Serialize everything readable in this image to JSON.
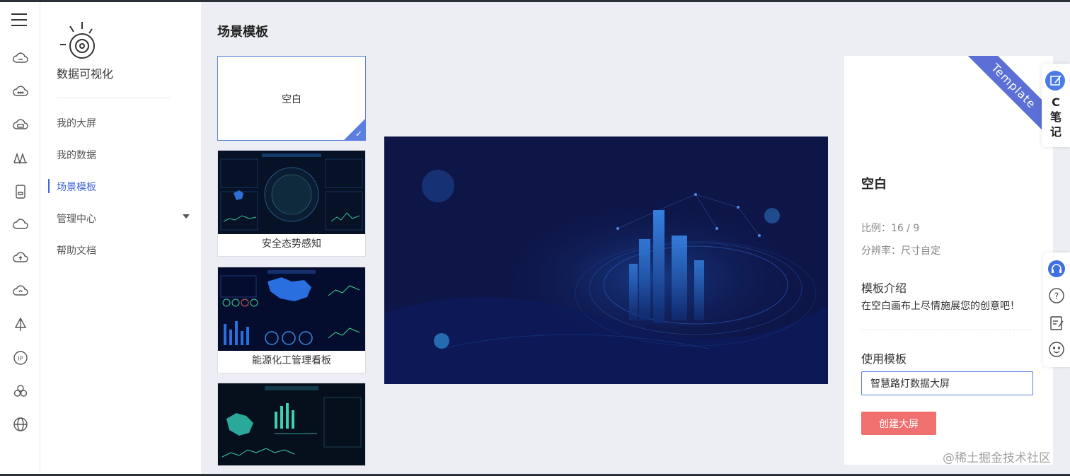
{
  "app": {
    "brand": "数据可视化"
  },
  "rail": {
    "icons": [
      "menu-icon",
      "cloud-icon",
      "cloud-dots-icon",
      "cloud-server-icon",
      "bridge-icon",
      "storage-icon",
      "cloud-icon",
      "cloud-upload-icon",
      "cloud-sync-icon",
      "sail-icon",
      "ip-icon",
      "cluster-icon",
      "globe-icon"
    ]
  },
  "nav": {
    "items": [
      {
        "label": "我的大屏"
      },
      {
        "label": "我的数据"
      },
      {
        "label": "场景模板",
        "active": true
      },
      {
        "label": "管理中心",
        "expandable": true
      },
      {
        "label": "帮助文档"
      }
    ]
  },
  "page": {
    "title": "场景模板"
  },
  "templates": [
    {
      "name": "空白",
      "selected": true
    },
    {
      "name": "安全态势感知"
    },
    {
      "name": "能源化工管理看板"
    },
    {
      "name": ""
    }
  ],
  "detail": {
    "ribbon": "Template",
    "title": "空白",
    "ratio": "比例：16 / 9",
    "resolution": "分辨率：尺寸自定",
    "intro_heading": "模板介绍",
    "intro_text": "在空白画布上尽情施展您的创意吧！",
    "use_label": "使用模板",
    "name_value": "智慧路灯数据大屏",
    "create_button": "创建大屏"
  },
  "floating": {
    "note_text": "C笔记"
  },
  "watermark": "@稀土掘金技术社区",
  "colors": {
    "accent": "#3f65d8",
    "button": "#f07070",
    "preview_bg": "#0e1547",
    "ribbon": "#5c6fd6"
  }
}
